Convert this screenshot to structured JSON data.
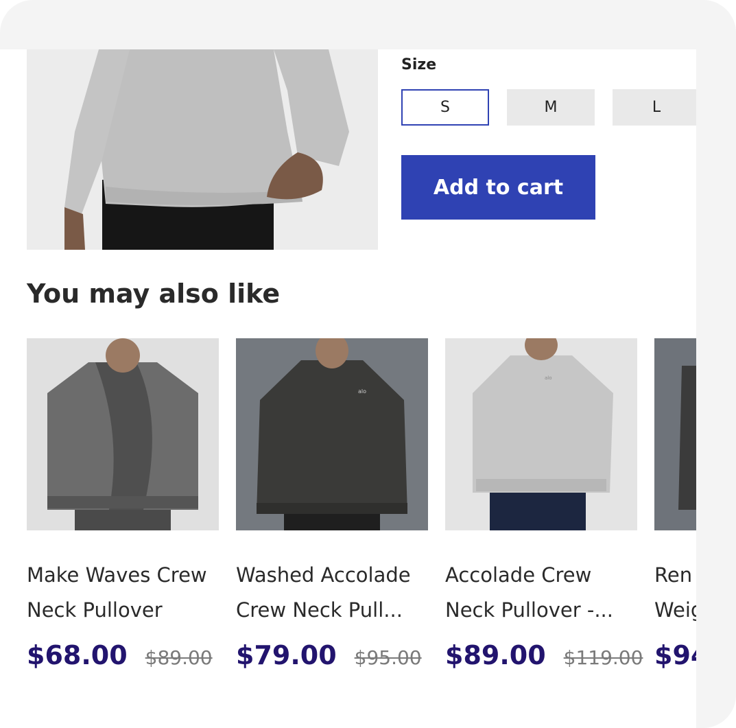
{
  "size": {
    "label": "Size",
    "options": [
      {
        "label": "S",
        "selected": true
      },
      {
        "label": "M",
        "selected": false
      },
      {
        "label": "L",
        "selected": false
      }
    ]
  },
  "cart": {
    "add_label": "Add to cart"
  },
  "recommendations": {
    "title": "You may also like",
    "products": [
      {
        "name": "Make Waves Crew\nNeck Pullover",
        "price": "$68.00",
        "old_price": "$89.00"
      },
      {
        "name": "Washed Accolade\nCrew Neck Pull...",
        "price": "$79.00",
        "old_price": "$95.00"
      },
      {
        "name": "Accolade Crew\nNeck Pullover -...",
        "price": "$89.00",
        "old_price": "$119.00"
      },
      {
        "name": "Ren\nWeig",
        "price": "$94",
        "old_price": ""
      }
    ]
  },
  "colors": {
    "accent": "#2f42b3",
    "price": "#22146e"
  }
}
